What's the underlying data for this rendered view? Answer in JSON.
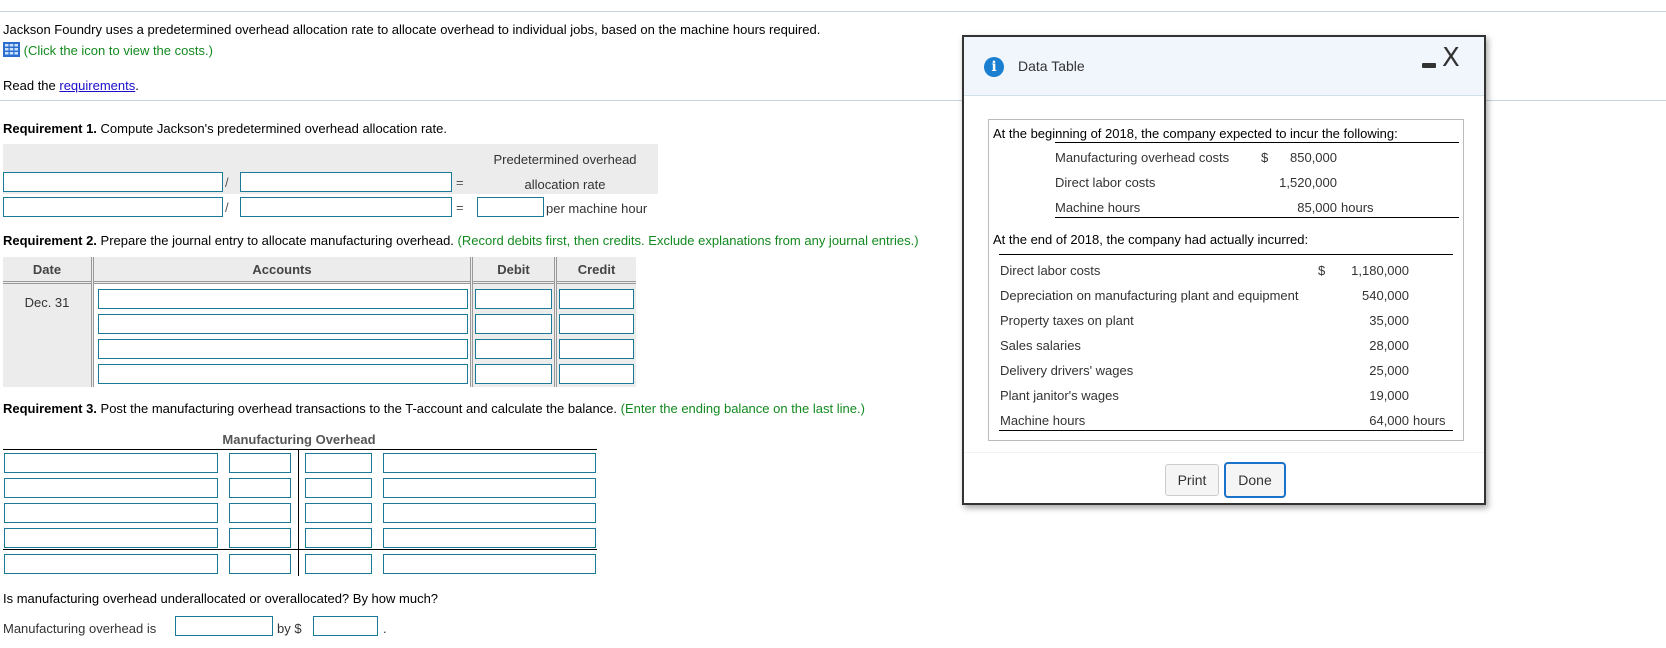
{
  "intro": {
    "description": "Jackson Foundry uses a predetermined overhead allocation rate to allocate overhead to individual jobs, based on the machine hours required.",
    "icon_hint": "(Click the icon to view the costs.)",
    "read_prefix": "Read the ",
    "requirements_link": "requirements",
    "read_suffix": "."
  },
  "req1": {
    "label": "Requirement 1.",
    "text": " Compute Jackson's predetermined overhead allocation rate.",
    "divide_symbol": "/",
    "equals_symbol": "=",
    "result_header_line1": "Predetermined overhead",
    "result_header_line2": "allocation rate",
    "unit_label": "per machine hour",
    "row1": {
      "numerator": "",
      "denominator": ""
    },
    "row2": {
      "numerator": "",
      "denominator": "",
      "result": ""
    }
  },
  "req2": {
    "label": "Requirement 2.",
    "text": " Prepare the journal entry to allocate manufacturing overhead. ",
    "instruction": "(Record debits first, then credits. Exclude explanations from any journal entries.)",
    "columns": [
      "Date",
      "Accounts",
      "Debit",
      "Credit"
    ],
    "date": "Dec. 31",
    "rows": [
      {
        "account": "",
        "debit": "",
        "credit": ""
      },
      {
        "account": "",
        "debit": "",
        "credit": ""
      },
      {
        "account": "",
        "debit": "",
        "credit": ""
      },
      {
        "account": "",
        "debit": "",
        "credit": ""
      }
    ]
  },
  "req3": {
    "label": "Requirement 3.",
    "text": " Post the manufacturing overhead transactions to the T-account and calculate the balance. ",
    "instruction": "(Enter the ending balance on the last line.)",
    "taccount_title": "Manufacturing Overhead",
    "rows": [
      {
        "left_label": "",
        "left_amount": "",
        "right_amount": "",
        "right_label": ""
      },
      {
        "left_label": "",
        "left_amount": "",
        "right_amount": "",
        "right_label": ""
      },
      {
        "left_label": "",
        "left_amount": "",
        "right_amount": "",
        "right_label": ""
      },
      {
        "left_label": "",
        "left_amount": "",
        "right_amount": "",
        "right_label": ""
      },
      {
        "left_label": "",
        "left_amount": "",
        "right_amount": "",
        "right_label": ""
      }
    ]
  },
  "question": {
    "text": "Is manufacturing overhead underallocated or overallocated? By how much?",
    "prefix": "Manufacturing overhead is",
    "by_label": "by $",
    "suffix": ".",
    "status_value": "",
    "amount_value": ""
  },
  "dialog": {
    "title": "Data Table",
    "info_icon": "i",
    "close_icon": "X",
    "expected_heading": "At the beginning of 2018, the company expected to incur the following:",
    "expected": [
      {
        "label": "Manufacturing overhead costs",
        "currency": "$",
        "value": "850,000",
        "unit": ""
      },
      {
        "label": "Direct labor costs",
        "currency": "",
        "value": "1,520,000",
        "unit": ""
      },
      {
        "label": "Machine hours",
        "currency": "",
        "value": "85,000",
        "unit": "hours"
      }
    ],
    "actual_heading": "At the end of 2018, the company had actually incurred:",
    "actual": [
      {
        "label": "Direct labor costs",
        "currency": "$",
        "value": "1,180,000",
        "unit": ""
      },
      {
        "label": "Depreciation on manufacturing plant and equipment",
        "currency": "",
        "value": "540,000",
        "unit": ""
      },
      {
        "label": "Property taxes on plant",
        "currency": "",
        "value": "35,000",
        "unit": ""
      },
      {
        "label": "Sales salaries",
        "currency": "",
        "value": "28,000",
        "unit": ""
      },
      {
        "label": "Delivery drivers' wages",
        "currency": "",
        "value": "25,000",
        "unit": ""
      },
      {
        "label": "Plant janitor's wages",
        "currency": "",
        "value": "19,000",
        "unit": ""
      },
      {
        "label": "Machine hours",
        "currency": "",
        "value": "64,000",
        "unit": "hours"
      }
    ],
    "print_label": "Print",
    "done_label": "Done"
  },
  "colors": {
    "input_border": "#1a7a96",
    "instruction_green": "#138a1f",
    "link_blue": "#1a0dcc",
    "info_blue": "#1a7fd0",
    "done_border": "#1a73c9"
  }
}
